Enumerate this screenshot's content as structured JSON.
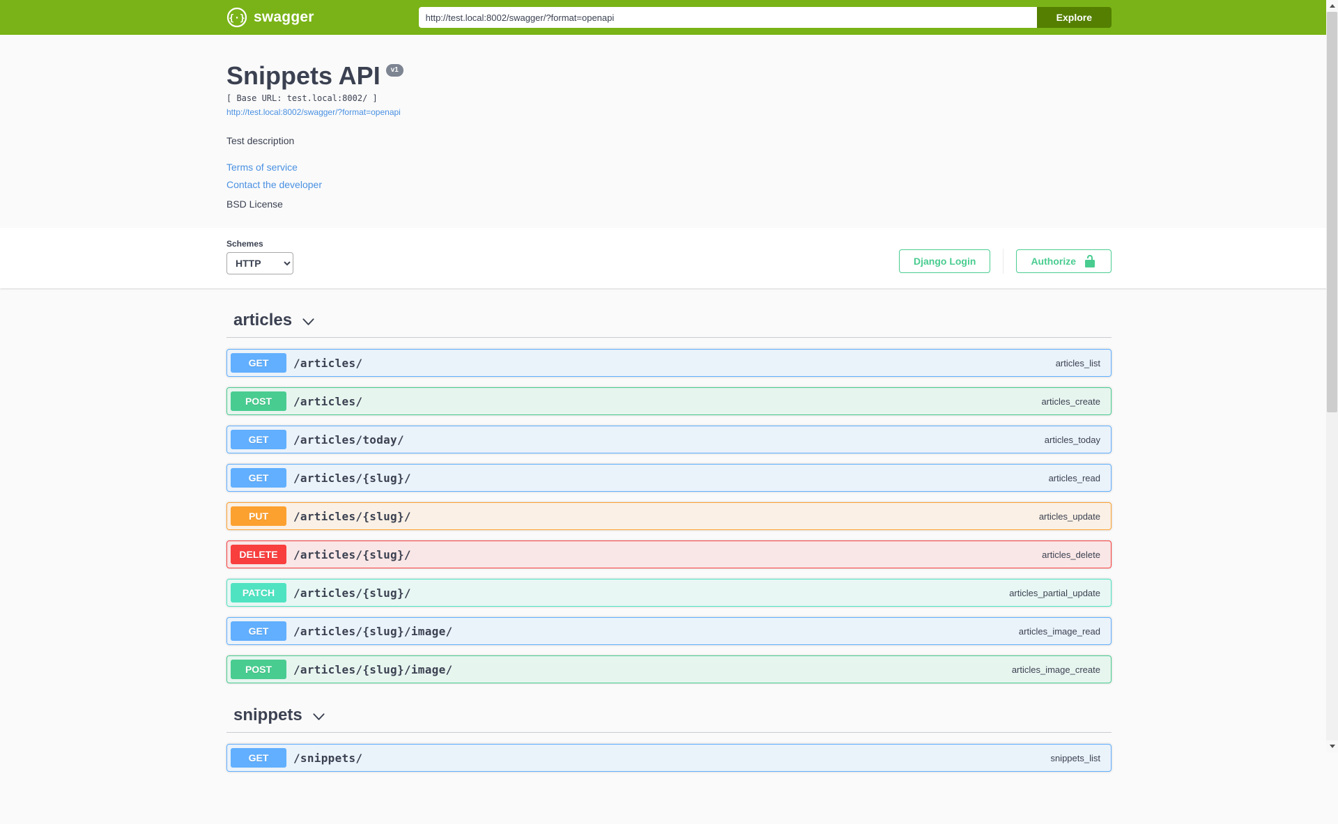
{
  "topbar": {
    "brand": "swagger",
    "url_value": "http://test.local:8002/swagger/?format=openapi",
    "explore_label": "Explore"
  },
  "info": {
    "title": "Snippets API",
    "version_badge": "v1",
    "base_url": "[ Base URL: test.local:8002/ ]",
    "spec_link": "http://test.local:8002/swagger/?format=openapi",
    "description": "Test description",
    "terms_link": "Terms of service",
    "contact_link": "Contact the developer",
    "license": "BSD License"
  },
  "schemes": {
    "label": "Schemes",
    "selected": "HTTP"
  },
  "auth": {
    "django_login_label": "Django Login",
    "authorize_label": "Authorize"
  },
  "colors": {
    "topbar_green": "#7ab317",
    "explore_button_green": "#547f00",
    "link_blue": "#4990e2",
    "heading_gray": "#3b4151",
    "authorize_green": "#49cc90"
  },
  "methods": {
    "GET": {
      "color": "#61affe",
      "bg": "rgba(97,175,254,0.1)"
    },
    "POST": {
      "color": "#49cc90",
      "bg": "rgba(73,204,144,0.1)"
    },
    "PUT": {
      "color": "#fca130",
      "bg": "rgba(252,161,48,0.1)"
    },
    "DELETE": {
      "color": "#f93e3e",
      "bg": "rgba(249,62,62,0.1)"
    },
    "PATCH": {
      "color": "#50e3c2",
      "bg": "rgba(80,227,194,0.1)"
    }
  },
  "sections": [
    {
      "name": "articles",
      "operations": [
        {
          "method": "GET",
          "path": "/articles/",
          "opid": "articles_list"
        },
        {
          "method": "POST",
          "path": "/articles/",
          "opid": "articles_create"
        },
        {
          "method": "GET",
          "path": "/articles/today/",
          "opid": "articles_today"
        },
        {
          "method": "GET",
          "path": "/articles/{slug}/",
          "opid": "articles_read"
        },
        {
          "method": "PUT",
          "path": "/articles/{slug}/",
          "opid": "articles_update"
        },
        {
          "method": "DELETE",
          "path": "/articles/{slug}/",
          "opid": "articles_delete"
        },
        {
          "method": "PATCH",
          "path": "/articles/{slug}/",
          "opid": "articles_partial_update"
        },
        {
          "method": "GET",
          "path": "/articles/{slug}/image/",
          "opid": "articles_image_read"
        },
        {
          "method": "POST",
          "path": "/articles/{slug}/image/",
          "opid": "articles_image_create"
        }
      ]
    },
    {
      "name": "snippets",
      "operations": [
        {
          "method": "GET",
          "path": "/snippets/",
          "opid": "snippets_list"
        }
      ]
    }
  ]
}
